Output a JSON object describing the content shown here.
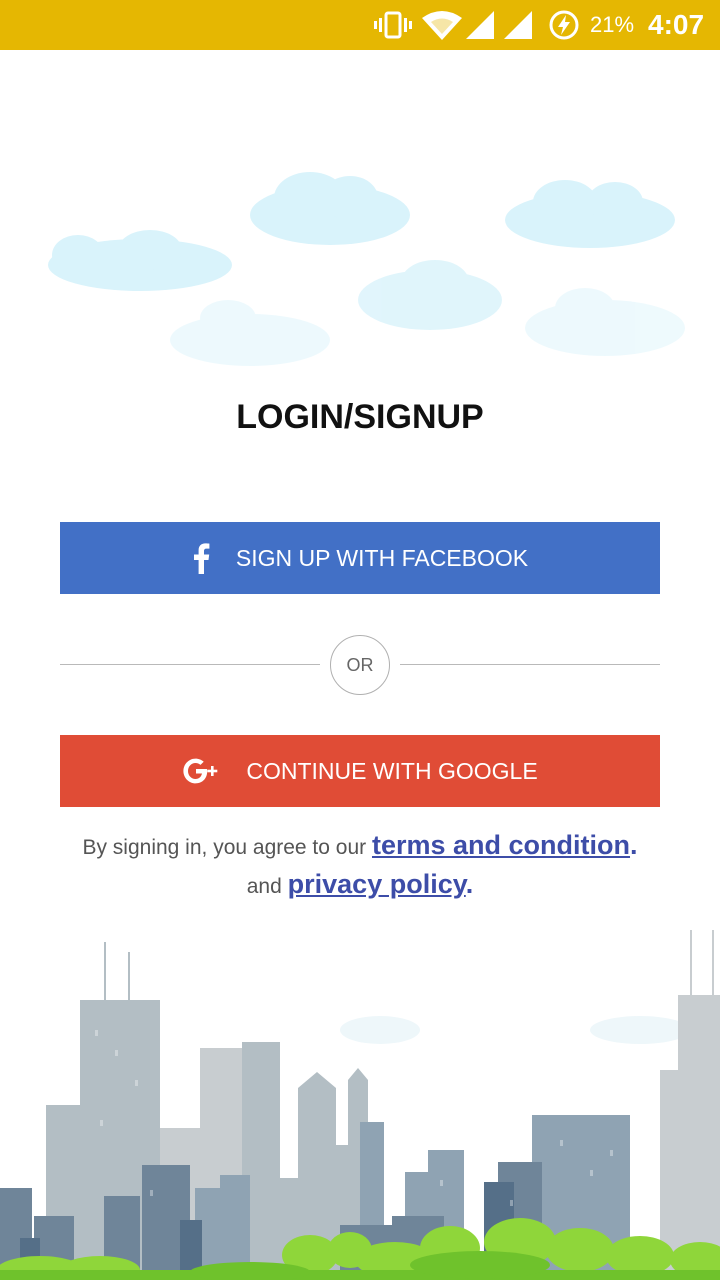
{
  "status_bar": {
    "battery_percent": "21%",
    "time": "4:07",
    "icons": [
      "vibrate-icon",
      "wifi-icon",
      "signal-icon",
      "signal-icon",
      "battery-saver-icon"
    ]
  },
  "title": "LOGIN/SIGNUP",
  "facebook_button": {
    "label": "SIGN UP WITH FACEBOOK",
    "icon": "facebook-icon",
    "color": "#4270c6"
  },
  "divider": {
    "label": "OR"
  },
  "google_button": {
    "label": "CONTINUE WITH GOOGLE",
    "icon": "google-plus-icon",
    "color": "#e04c36"
  },
  "legal": {
    "prefix": "By signing in, you agree to our",
    "terms_link": "terms and condition",
    "terms_suffix": ".",
    "and": "and",
    "privacy_link": "privacy policy",
    "privacy_suffix": "."
  },
  "colors": {
    "status_bar": "#e5b702",
    "link": "#3d4da8"
  }
}
